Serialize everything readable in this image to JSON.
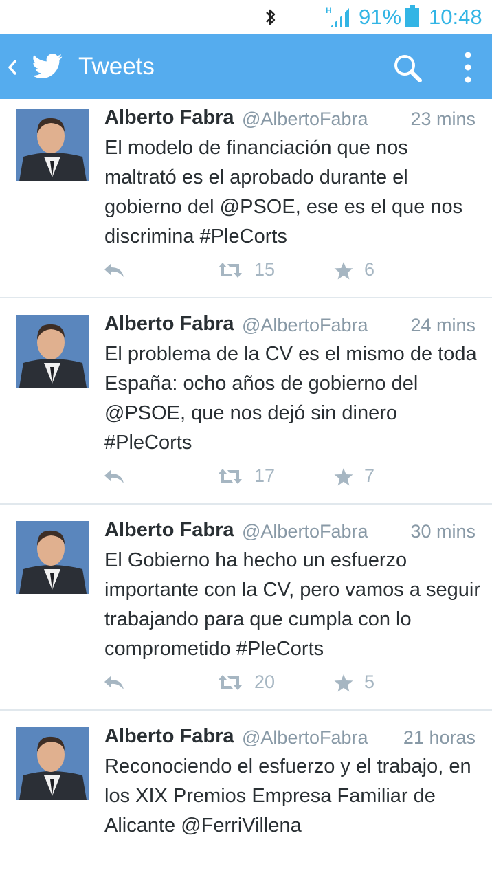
{
  "status_bar": {
    "bluetooth_icon": "bluetooth-icon",
    "signal_icon": "signal-h-icon",
    "signal_label": "H",
    "battery_percent": "91%",
    "battery_icon": "battery-icon",
    "time": "10:48"
  },
  "action_bar": {
    "back_icon": "chevron-left-icon",
    "logo_icon": "twitter-bird-icon",
    "title": "Tweets",
    "search_icon": "search-icon",
    "overflow_icon": "overflow-menu-icon",
    "background_color": "#55acee"
  },
  "tweets": [
    {
      "name": "Alberto Fabra",
      "handle": "@AlbertoFabra",
      "time": "23 mins",
      "text": "El modelo de financiación que nos maltrató es el aprobado durante el gobierno del @PSOE, ese es el que nos discrimina #PleCorts",
      "retweets": "15",
      "favorites": "6"
    },
    {
      "name": "Alberto Fabra",
      "handle": "@AlbertoFabra",
      "time": "24 mins",
      "text": "El problema de la CV es el mismo de toda España: ocho años de gobierno del @PSOE, que nos dejó sin dinero #PleCorts",
      "retweets": "17",
      "favorites": "7"
    },
    {
      "name": "Alberto Fabra",
      "handle": "@AlbertoFabra",
      "time": "30 mins",
      "text": "El Gobierno ha hecho un esfuerzo importante con la CV, pero vamos a seguir trabajando para que cumpla con lo comprometido #PleCorts",
      "retweets": "20",
      "favorites": "5"
    },
    {
      "name": "Alberto Fabra",
      "handle": "@AlbertoFabra",
      "time": "21 horas",
      "text": "Reconociendo el esfuerzo y el trabajo, en los XIX Premios Empresa Familiar de Alicante @FerriVillena"
    }
  ],
  "icons": {
    "reply": "reply-icon",
    "retweet": "retweet-icon",
    "favorite": "star-icon"
  },
  "colors": {
    "accent": "#55acee",
    "status_icons": "#33b5e5",
    "meta_text": "#8899a6",
    "action_icons": "#a6b6c2",
    "body_text": "#292f33",
    "divider": "#e1e8ed"
  }
}
